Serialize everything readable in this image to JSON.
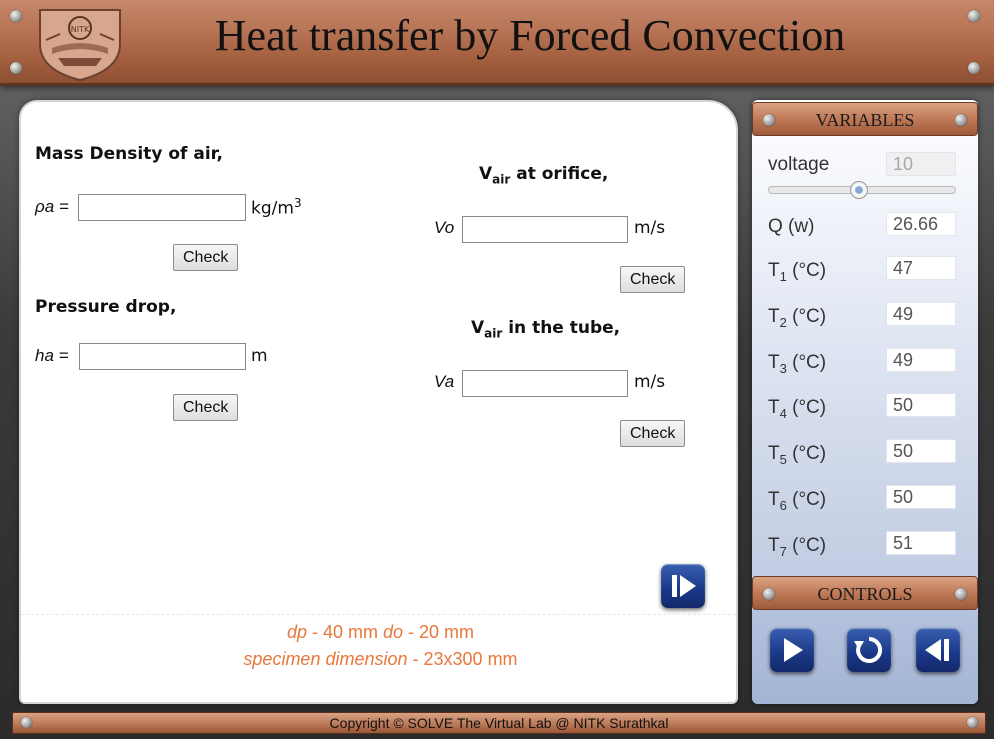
{
  "header": {
    "title": "Heat transfer by Forced Convection",
    "logo_text": "NITK"
  },
  "main": {
    "density": {
      "heading": "Mass Density of air,",
      "label": "ρa =",
      "value": "",
      "unit": "kg/m",
      "unit_sup": "3",
      "check_label": "Check"
    },
    "pressure": {
      "heading": "Pressure drop,",
      "label": "ha =",
      "value": "",
      "unit": "m",
      "check_label": "Check"
    },
    "orifice": {
      "heading_main": "V",
      "heading_sub": "air",
      "heading_rest": " at orifice,",
      "label": "Vo",
      "value": "",
      "unit": "m/s",
      "check_label": "Check"
    },
    "tube": {
      "heading_main": "V",
      "heading_sub": "air",
      "heading_rest": " in the tube,",
      "label": "Va",
      "value": "",
      "unit": "m/s",
      "check_label": "Check"
    },
    "note_line1_a": "dp",
    "note_line1_b": " - 40 mm ",
    "note_line1_c": "do",
    "note_line1_d": " - 20 mm",
    "note_line2_a": "specimen dimension",
    "note_line2_b": " - 23x300 mm",
    "next_icon": "skip-forward-icon"
  },
  "variables": {
    "title": "VARIABLES",
    "voltage_label": "voltage",
    "voltage_value": "10",
    "voltage_level": 0.5,
    "q_label": "Q (w)",
    "q_value": "26.66",
    "temps": [
      {
        "pre": "T",
        "sub": "1",
        "post": " (°C)",
        "value": "47"
      },
      {
        "pre": "T",
        "sub": "2",
        "post": " (°C)",
        "value": "49"
      },
      {
        "pre": "T",
        "sub": "3",
        "post": " (°C)",
        "value": "49"
      },
      {
        "pre": "T",
        "sub": "4",
        "post": " (°C)",
        "value": "50"
      },
      {
        "pre": "T",
        "sub": "5",
        "post": " (°C)",
        "value": "50"
      },
      {
        "pre": "T",
        "sub": "6",
        "post": " (°C)",
        "value": "50"
      },
      {
        "pre": "T",
        "sub": "7",
        "post": " (°C)",
        "value": "51"
      }
    ]
  },
  "controls": {
    "title": "CONTROLS",
    "buttons": [
      "play-icon",
      "reset-icon",
      "step-back-icon"
    ]
  },
  "footer": {
    "copyright": "Copyright © SOLVE The Virtual Lab @ NITK Surathkal"
  },
  "colors": {
    "accent_copper": "#b87557",
    "note_orange": "#e8773a",
    "button_blue": "#1c3a8a"
  }
}
